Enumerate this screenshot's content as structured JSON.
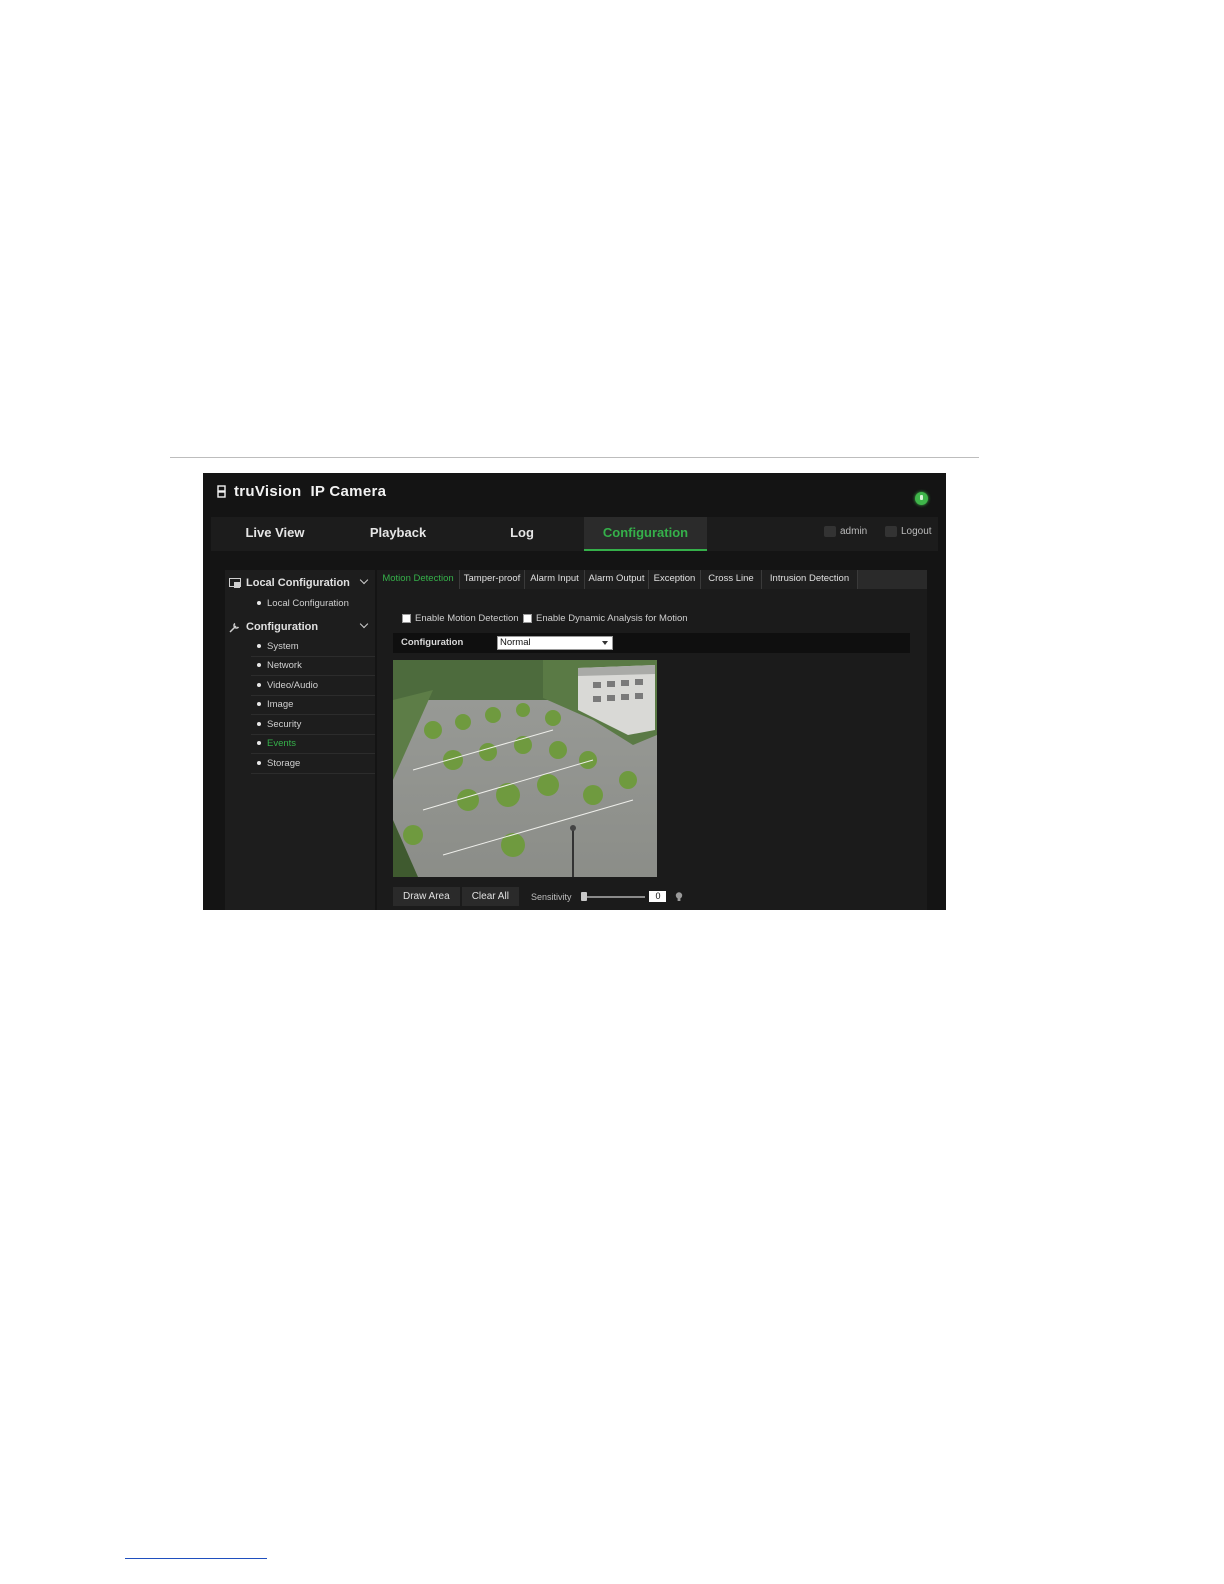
{
  "app": {
    "brand": "truVision",
    "product": "IP Camera"
  },
  "topnav": {
    "tabs": [
      "Live View",
      "Playback",
      "Log",
      "Configuration"
    ],
    "active_tab": "Configuration",
    "user": "admin",
    "logout": "Logout"
  },
  "sidebar": {
    "local_heading": "Local Configuration",
    "local_items": [
      "Local Configuration"
    ],
    "config_heading": "Configuration",
    "config_items": [
      "System",
      "Network",
      "Video/Audio",
      "Image",
      "Security",
      "Events",
      "Storage"
    ],
    "active_item": "Events"
  },
  "subtabs": {
    "items": [
      "Motion Detection",
      "Tamper-proof",
      "Alarm Input",
      "Alarm Output",
      "Exception",
      "Cross Line",
      "Intrusion Detection"
    ],
    "active": "Motion Detection"
  },
  "form": {
    "enable_motion_label": "Enable Motion Detection",
    "enable_motion_checked": false,
    "enable_dynamic_label": "Enable Dynamic Analysis for Motion",
    "enable_dynamic_checked": false,
    "configuration_label": "Configuration",
    "configuration_value": "Normal"
  },
  "controls": {
    "draw_area": "Draw Area",
    "clear_all": "Clear All",
    "sensitivity_label": "Sensitivity",
    "sensitivity_value": "0"
  },
  "colors": {
    "accent": "#35b04a",
    "background": "#141414"
  },
  "icons": [
    "logo-icon",
    "status-icon",
    "user-icon",
    "logout-icon",
    "local-config-icon",
    "wrench-icon",
    "chevron-down-icon",
    "bulb-icon"
  ]
}
